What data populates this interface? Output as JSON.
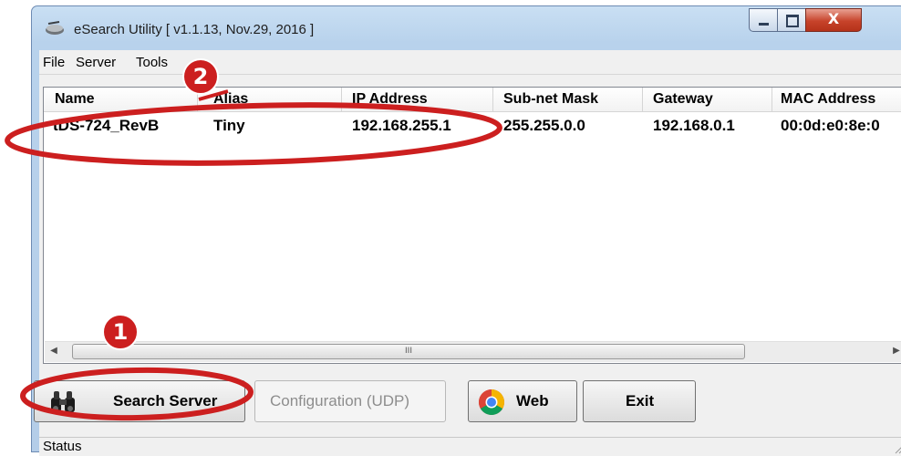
{
  "window": {
    "title": "eSearch Utility [ v1.1.13, Nov.29, 2016 ]",
    "close_glyph": "X"
  },
  "menu": {
    "items": [
      "File",
      "Server",
      "Tools"
    ]
  },
  "table": {
    "columns": [
      "Name",
      "Alias",
      "IP Address",
      "Sub-net Mask",
      "Gateway",
      "MAC Address"
    ],
    "rows": [
      {
        "name": "tDS-724_RevB",
        "alias": "Tiny",
        "ip": "192.168.255.1",
        "mask": "255.255.0.0",
        "gateway": "192.168.0.1",
        "mac": "00:0d:e0:8e:0"
      }
    ]
  },
  "scrollbar": {
    "left_arrow": "◀",
    "right_arrow": "▶",
    "grip": "III"
  },
  "buttons": {
    "search": "Search Server",
    "config": "Configuration (UDP)",
    "web": "Web",
    "exit": "Exit"
  },
  "status": {
    "label": "Status"
  },
  "annotations": [
    {
      "number": "1"
    },
    {
      "number": "2"
    }
  ],
  "colors": {
    "annotation": "#cc1f1f",
    "title_bar": "#b8d2ec"
  }
}
